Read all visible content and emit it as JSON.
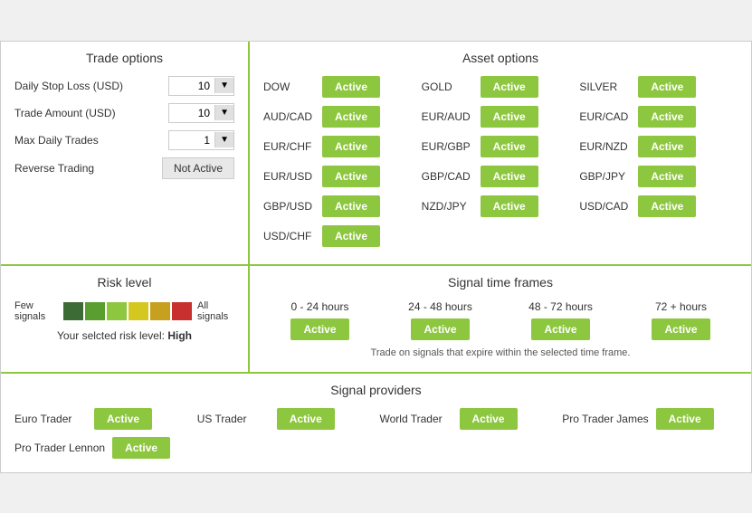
{
  "trade_options": {
    "title": "Trade options",
    "fields": [
      {
        "label": "Daily Stop Loss (USD)",
        "value": "10"
      },
      {
        "label": "Trade Amount (USD)",
        "value": "10"
      },
      {
        "label": "Max Daily Trades",
        "value": "1"
      },
      {
        "label": "Reverse Trading",
        "value": "Not Active"
      }
    ]
  },
  "asset_options": {
    "title": "Asset options",
    "assets": [
      {
        "name": "DOW",
        "status": "Active"
      },
      {
        "name": "GOLD",
        "status": "Active"
      },
      {
        "name": "SILVER",
        "status": "Active"
      },
      {
        "name": "AUD/CAD",
        "status": "Active"
      },
      {
        "name": "EUR/AUD",
        "status": "Active"
      },
      {
        "name": "EUR/CAD",
        "status": "Active"
      },
      {
        "name": "EUR/CHF",
        "status": "Active"
      },
      {
        "name": "EUR/GBP",
        "status": "Active"
      },
      {
        "name": "EUR/NZD",
        "status": "Active"
      },
      {
        "name": "EUR/USD",
        "status": "Active"
      },
      {
        "name": "GBP/CAD",
        "status": "Active"
      },
      {
        "name": "GBP/JPY",
        "status": "Active"
      },
      {
        "name": "GBP/USD",
        "status": "Active"
      },
      {
        "name": "NZD/JPY",
        "status": "Active"
      },
      {
        "name": "USD/CAD",
        "status": "Active"
      },
      {
        "name": "USD/CHF",
        "status": "Active"
      }
    ]
  },
  "risk_level": {
    "title": "Risk level",
    "few_signals": "Few signals",
    "all_signals": "All signals",
    "segments": [
      {
        "color": "#3d6b35"
      },
      {
        "color": "#5a9e2f"
      },
      {
        "color": "#8dc63f"
      },
      {
        "color": "#d4c820"
      },
      {
        "color": "#c8a020"
      },
      {
        "color": "#c83030"
      }
    ],
    "selected_text": "Your selcted risk level:",
    "selected_value": "High"
  },
  "signal_timeframes": {
    "title": "Signal time frames",
    "frames": [
      {
        "label": "0 - 24 hours",
        "status": "Active"
      },
      {
        "label": "24 - 48 hours",
        "status": "Active"
      },
      {
        "label": "48 - 72 hours",
        "status": "Active"
      },
      {
        "label": "72 + hours",
        "status": "Active"
      }
    ],
    "note": "Trade on signals that expire within the selected time frame."
  },
  "signal_providers": {
    "title": "Signal providers",
    "providers": [
      {
        "name": "Euro Trader",
        "status": "Active"
      },
      {
        "name": "US Trader",
        "status": "Active"
      },
      {
        "name": "World Trader",
        "status": "Active"
      },
      {
        "name": "Pro Trader James",
        "status": "Active"
      },
      {
        "name": "Pro Trader Lennon",
        "status": "Active"
      }
    ]
  },
  "dropdown_arrow": "▼"
}
